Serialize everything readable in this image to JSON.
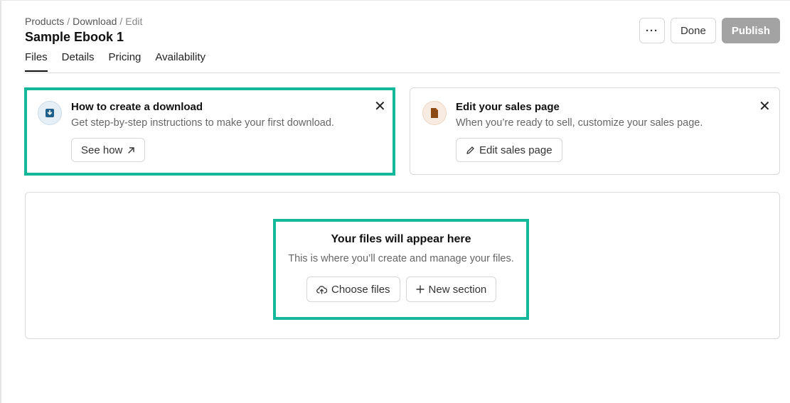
{
  "breadcrumb": {
    "items": [
      "Products",
      "Download",
      "Edit"
    ],
    "separator": "/"
  },
  "page": {
    "title": "Sample Ebook 1"
  },
  "tabs": [
    {
      "label": "Files",
      "active": true
    },
    {
      "label": "Details",
      "active": false
    },
    {
      "label": "Pricing",
      "active": false
    },
    {
      "label": "Availability",
      "active": false
    }
  ],
  "actions": {
    "more_label": "···",
    "done_label": "Done",
    "publish_label": "Publish"
  },
  "cards": {
    "download": {
      "icon": "download-icon",
      "title": "How to create a download",
      "desc": "Get step-by-step instructions to make your first download.",
      "button_label": "See how",
      "button_icon": "arrow-up-right-icon",
      "close_label": "✕",
      "accent": "#1f5f8b"
    },
    "sales": {
      "icon": "document-icon",
      "title": "Edit your sales page",
      "desc": "When you’re ready to sell, customize your sales page.",
      "button_label": "Edit sales page",
      "button_icon": "pencil-icon",
      "close_label": "✕",
      "accent": "#8b4a14"
    }
  },
  "empty_state": {
    "title": "Your files will appear here",
    "desc": "This is where you’ll create and manage your files.",
    "choose_label": "Choose files",
    "choose_icon": "cloud-upload-icon",
    "new_section_label": "New section",
    "new_section_icon": "plus-icon"
  },
  "colors": {
    "highlight": "#15b79a",
    "publish_bg": "#a3a3a3"
  }
}
